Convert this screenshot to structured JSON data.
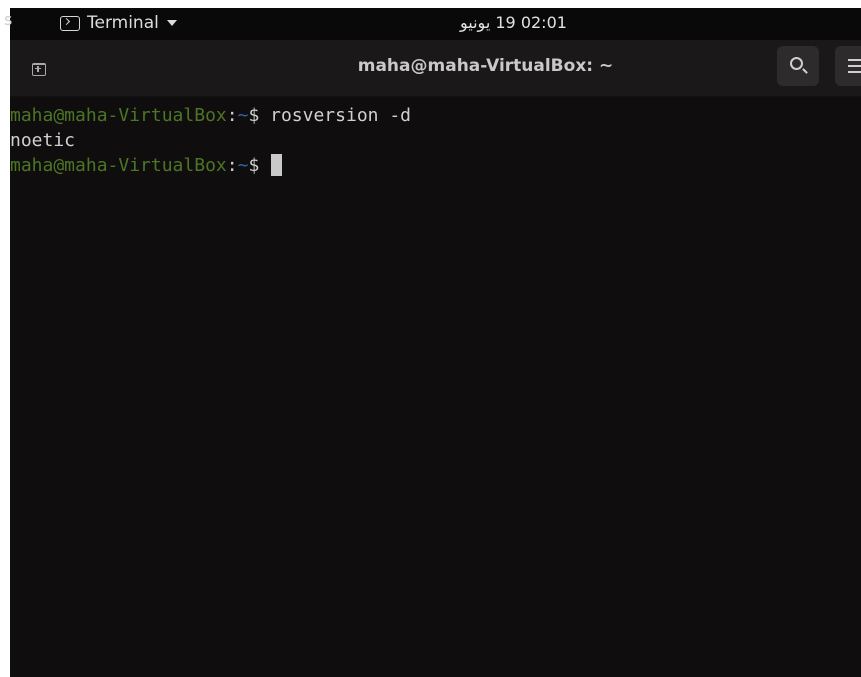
{
  "top_bar": {
    "activities_partial": "s",
    "app_menu_label": "Terminal",
    "clock": "02:01 19 يونيو"
  },
  "window": {
    "title": "maha@maha-VirtualBox: ~",
    "icons": {
      "new_tab": "new-tab-icon",
      "search": "search-icon",
      "menu": "hamburger-menu-icon"
    }
  },
  "terminal": {
    "lines": [
      {
        "user_host": "maha@maha-VirtualBox",
        "sep": ":",
        "path": "~",
        "symbol": "$ ",
        "command": "rosversion -d"
      },
      {
        "output": "noetic"
      },
      {
        "user_host": "maha@maha-VirtualBox",
        "sep": ":",
        "path": "~",
        "symbol": "$ ",
        "command": ""
      }
    ],
    "colors": {
      "background": "#0f0d0e",
      "user_host": "#5a8a2a",
      "path": "#3465a4",
      "text": "#d0d0d0"
    }
  }
}
